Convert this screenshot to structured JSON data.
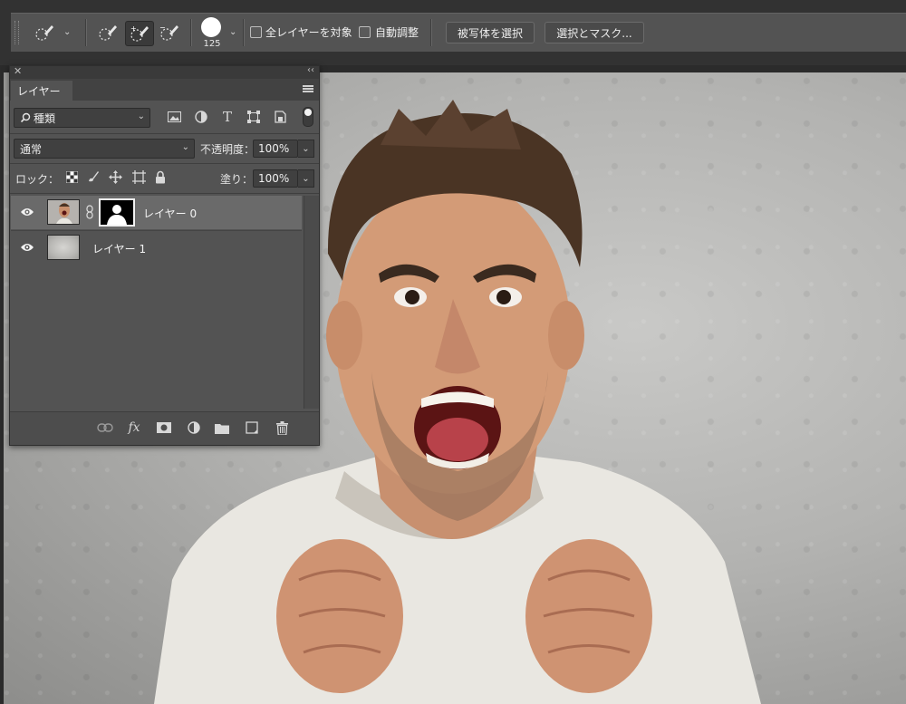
{
  "options_bar": {
    "brush_size": "125",
    "sample_all_layers_label": "全レイヤーを対象",
    "auto_enhance_label": "自動調整",
    "select_subject_button": "被写体を選択",
    "select_and_mask_button": "選択とマスク..."
  },
  "layers_panel": {
    "tab_title": "レイヤー",
    "filter_kind": "種類",
    "blend_mode": "通常",
    "opacity_label": "不透明度：",
    "opacity_value": "100%",
    "lock_label": "ロック：",
    "fill_label": "塗り：",
    "fill_value": "100%",
    "layers": [
      {
        "name": "レイヤー 0",
        "visible": true,
        "selected": true,
        "has_mask": true
      },
      {
        "name": "レイヤー 1",
        "visible": true,
        "selected": false,
        "has_mask": false
      }
    ],
    "footer_fx_label": "fx"
  },
  "icons": {
    "toolbar": [
      "brush-preset-icon",
      "quick-selection-icon",
      "add-to-selection-icon",
      "subtract-from-selection-icon"
    ],
    "filters": [
      "pixel-layer-filter-icon",
      "adjustment-filter-icon",
      "type-filter-icon",
      "shape-filter-icon",
      "smart-object-filter-icon"
    ],
    "locks": [
      "lock-transparent-icon",
      "lock-image-icon",
      "lock-position-icon",
      "lock-artboard-icon",
      "lock-all-icon"
    ],
    "footer": [
      "link-layers-icon",
      "fx-icon",
      "add-mask-icon",
      "adjustment-layer-icon",
      "group-folder-icon",
      "new-layer-icon",
      "trash-icon"
    ]
  }
}
